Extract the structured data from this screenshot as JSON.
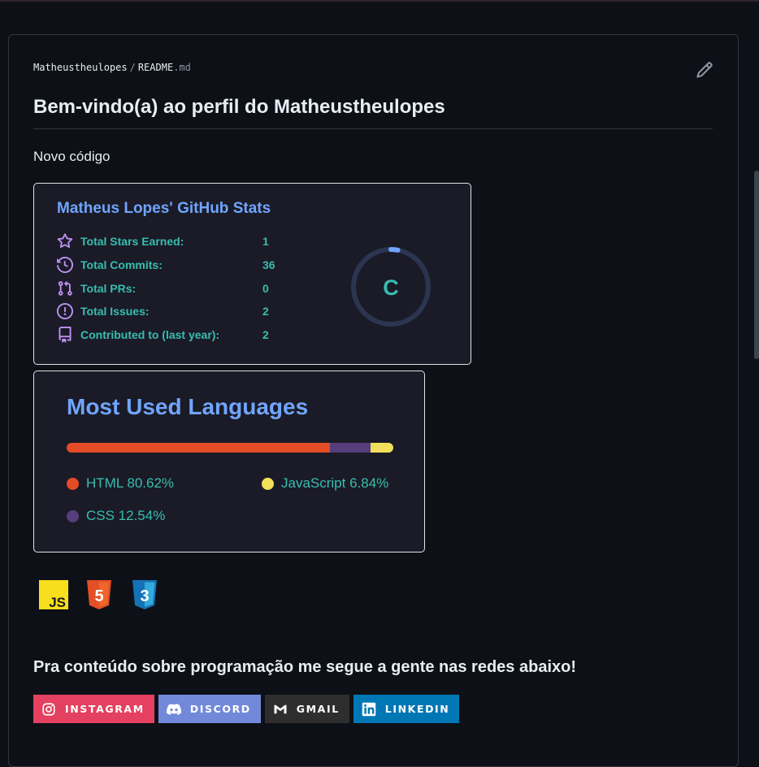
{
  "breadcrumb": {
    "owner": "Matheustheulopes",
    "separator": "/",
    "file": "README",
    "ext": ".md"
  },
  "heading": "Bem-vindo(a) ao perfil do Matheustheulopes",
  "intro": "Novo código",
  "stats_card": {
    "title": "Matheus Lopes' GitHub Stats",
    "rows": [
      {
        "icon": "star-icon",
        "label": "Total Stars Earned:",
        "value": "1"
      },
      {
        "icon": "commits-history-icon",
        "label": "Total Commits:",
        "value": "36"
      },
      {
        "icon": "pull-request-icon",
        "label": "Total PRs:",
        "value": "0"
      },
      {
        "icon": "issue-icon",
        "label": "Total Issues:",
        "value": "2"
      },
      {
        "icon": "repo-icon",
        "label": "Contributed to (last year):",
        "value": "2"
      }
    ],
    "rank": "C",
    "rank_progress": 0.03
  },
  "languages_card": {
    "title": "Most Used Languages",
    "languages": [
      {
        "name": "HTML",
        "percent": 80.62,
        "label": "HTML 80.62%",
        "color": "#e34c26"
      },
      {
        "name": "CSS",
        "percent": 12.54,
        "label": "CSS 12.54%",
        "color": "#563d7c"
      },
      {
        "name": "JavaScript",
        "percent": 6.84,
        "label": "JavaScript 6.84%",
        "color": "#f1e05a"
      }
    ]
  },
  "tech_icons": [
    {
      "name": "javascript-icon",
      "text": "JS"
    },
    {
      "name": "html5-icon",
      "text": "5"
    },
    {
      "name": "css3-icon",
      "text": "3"
    }
  ],
  "social_heading": "Pra conteúdo sobre programação me segue a gente nas redes abaixo!",
  "social_buttons": [
    {
      "label": "INSTAGRAM",
      "color": "#e4405f",
      "icon": "instagram-icon"
    },
    {
      "label": "DISCORD",
      "color": "#7289da",
      "icon": "discord-icon"
    },
    {
      "label": "GMAIL",
      "color": "#2e2e2e",
      "icon": "gmail-icon"
    },
    {
      "label": "LINKEDIN",
      "color": "#0077b5",
      "icon": "linkedin-icon"
    }
  ],
  "theme": {
    "accent_blue": "#70a5fd",
    "accent_teal": "#38bdae",
    "icon_purple": "#bf91f3",
    "card_bg": "#1a1b27",
    "page_bg": "#0d1117"
  }
}
